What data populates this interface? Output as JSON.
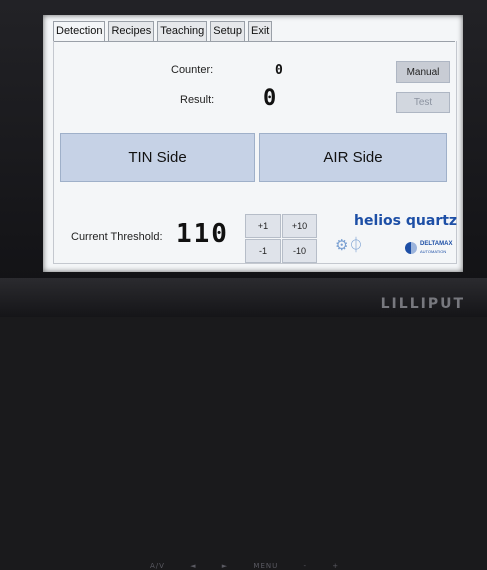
{
  "tabs": [
    "Detection",
    "Recipes",
    "Teaching",
    "Setup",
    "Exit"
  ],
  "detection": {
    "counter_label": "Counter:",
    "counter_value": "0",
    "result_label": "Result:",
    "result_value": "0",
    "tin_label": "TIN Side",
    "air_label": "AIR Side",
    "threshold_label": "Current Threshold:",
    "threshold_value": "110",
    "adjust": {
      "plus1": "+1",
      "plus10": "+10",
      "minus1": "-1",
      "minus10": "-10"
    },
    "manual_label": "Manual",
    "test_label": "Test"
  },
  "logos": {
    "helios": "helios quartz",
    "delta_line1": "DELTAMAX",
    "delta_line2": "AUTOMATION"
  },
  "bezel": {
    "brand": "LILLIPUT",
    "controls": [
      "A/V",
      "◄",
      "►",
      "MENU",
      "-",
      "+"
    ]
  },
  "colors": {
    "brand_blue": "#1d4fa6",
    "side_button": "#c6d2e6"
  },
  "icons": [
    "quartz-logo-icon",
    "deltamax-logo-icon"
  ]
}
